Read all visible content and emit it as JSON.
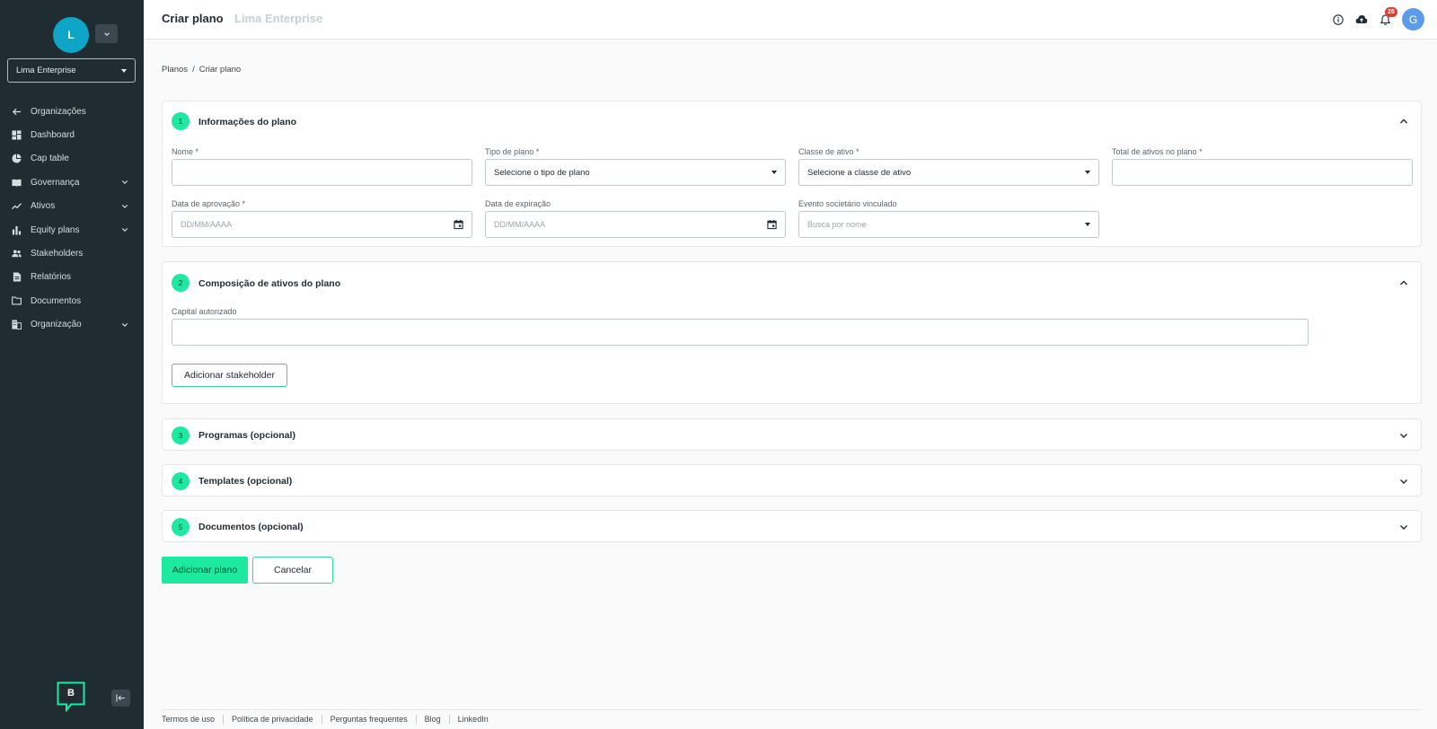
{
  "sidebar": {
    "org_initial": "L",
    "org_name": "Lima Enterprise",
    "brand_letter": "B",
    "items": [
      {
        "label": "Organizações",
        "icon": "arrow-left-icon",
        "expandable": false
      },
      {
        "label": "Dashboard",
        "icon": "dashboard-icon",
        "expandable": false
      },
      {
        "label": "Cap table",
        "icon": "pie-chart-icon",
        "expandable": false
      },
      {
        "label": "Governança",
        "icon": "book-icon",
        "expandable": true
      },
      {
        "label": "Ativos",
        "icon": "trend-line-icon",
        "expandable": true
      },
      {
        "label": "Equity plans",
        "icon": "bar-chart-icon",
        "expandable": true
      },
      {
        "label": "Stakeholders",
        "icon": "people-icon",
        "expandable": false
      },
      {
        "label": "Relatórios",
        "icon": "document-icon",
        "expandable": false
      },
      {
        "label": "Documentos",
        "icon": "folder-icon",
        "expandable": false
      },
      {
        "label": "Organização",
        "icon": "building-icon",
        "expandable": true
      }
    ]
  },
  "header": {
    "title": "Criar plano",
    "subtitle": "Lima Enterprise",
    "notification_count": "26",
    "user_initial": "G"
  },
  "breadcrumb": {
    "root": "Planos",
    "separator": "/",
    "current": "Criar plano"
  },
  "section1": {
    "step": "1",
    "title": "Informações do plano",
    "fields": {
      "nome": {
        "label": "Nome *",
        "value": ""
      },
      "tipo": {
        "label": "Tipo de plano *",
        "value": "Selecione o tipo de plano"
      },
      "classe": {
        "label": "Classe de ativo *",
        "value": "Selecione a classe de ativo"
      },
      "total": {
        "label": "Total de ativos no plano *",
        "value": ""
      },
      "aprovacao": {
        "label": "Data de aprovação *",
        "placeholder": "DD/MM/AAAA"
      },
      "expiracao": {
        "label": "Data de expiração",
        "placeholder": "DD/MM/AAAA"
      },
      "evento": {
        "label": "Evento societário vinculado",
        "placeholder": "Busca por nome"
      }
    }
  },
  "section2": {
    "step": "2",
    "title": "Composição de ativos do plano",
    "capital_label": "Capital autorizado",
    "capital_value": "",
    "add_stakeholder": "Adicionar stakeholder"
  },
  "section3": {
    "step": "3",
    "title": "Programas (opcional)"
  },
  "section4": {
    "step": "4",
    "title": "Templates (opcional)"
  },
  "section5": {
    "step": "5",
    "title": "Documentos (opcional)"
  },
  "actions": {
    "submit": "Adicionar plano",
    "cancel": "Cancelar"
  },
  "footer": {
    "links": [
      "Termos de uso",
      "Política de privacidade",
      "Perguntas frequentes",
      "Blog",
      "LinkedIn"
    ]
  },
  "colors": {
    "sidebar_bg": "#1f2d33",
    "accent": "#1de9a0",
    "org_avatar": "#0ea5c6",
    "user_avatar": "#5b9ce8",
    "badge": "#e53935"
  }
}
